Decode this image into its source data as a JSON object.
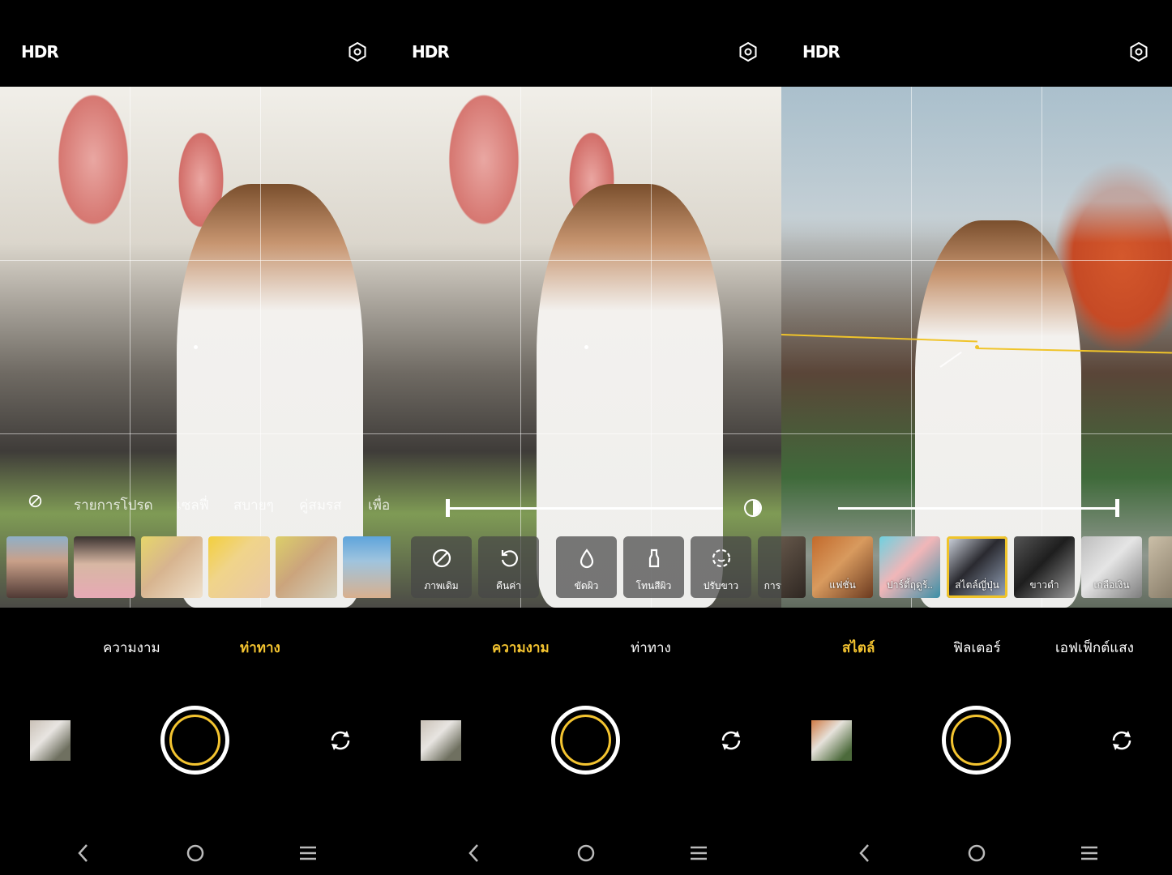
{
  "panels": [
    {
      "topbar": {
        "hdr_label": "HDR",
        "settings_icon": "settings-icon"
      },
      "pose_options": {
        "labels": [
          "รายการโปรด",
          "เซลฟี่",
          "สบายๆ",
          "คู่สมรส",
          "เพื่อ"
        ]
      },
      "modes": {
        "beauty": "ความงาม",
        "pose": "ท่าทาง"
      },
      "active_mode": "ท่าทาง"
    },
    {
      "topbar": {
        "hdr_label": "HDR",
        "settings_icon": "settings-icon"
      },
      "beauty_options": {
        "labels": [
          "ภาพเดิม",
          "คืนค่า",
          "ขัดผิว",
          "โทนสีผิว",
          "ปรับขาว",
          "การนีอ"
        ]
      },
      "modes": {
        "beauty": "ความงาม",
        "pose": "ท่าทาง"
      },
      "active_mode": "ความงาม"
    },
    {
      "topbar": {
        "hdr_label": "HDR",
        "settings_icon": "settings-icon"
      },
      "style_options": {
        "labels": [
          "แฟชั่น",
          "ปาร์ตี้ฤดูร้..",
          "สไตล์ญี่ปุ่น",
          "ขาวดำ",
          "เกลือเงิน"
        ],
        "selected": "สไตล์ญี่ปุ่น"
      },
      "modes": {
        "style": "สไตล์",
        "filter": "ฟิลเตอร์",
        "light": "เอฟเฟ็กต์แสง"
      },
      "active_mode": "สไตล์"
    }
  ],
  "accent_color": "#f4c430"
}
